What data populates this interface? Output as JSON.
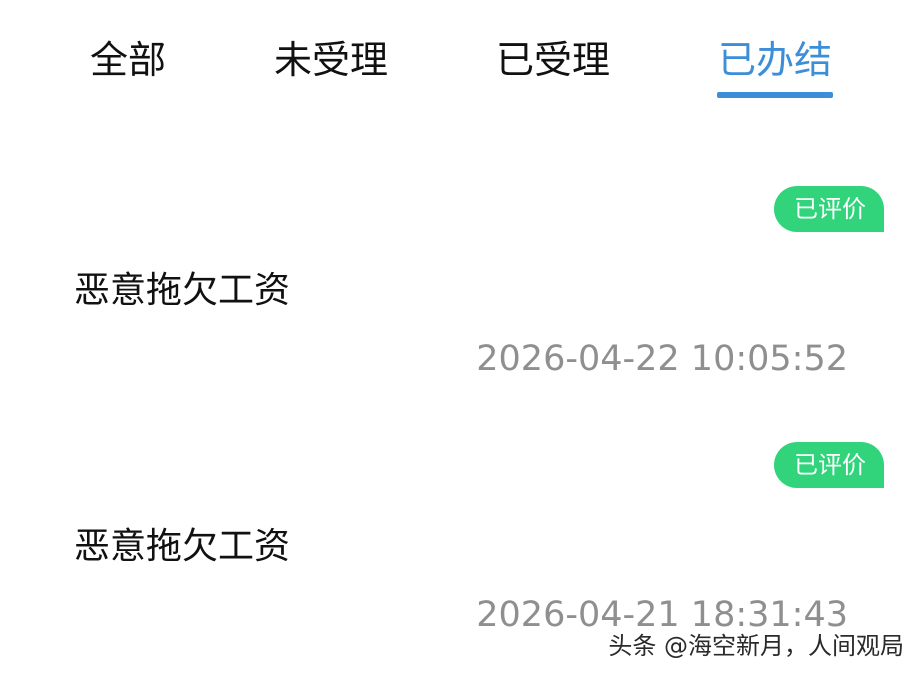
{
  "tabs": [
    {
      "label": "全部",
      "active": false
    },
    {
      "label": "未受理",
      "active": false
    },
    {
      "label": "已受理",
      "active": false
    },
    {
      "label": "已办结",
      "active": true
    }
  ],
  "colors": {
    "accent": "#3d8ed8",
    "badge": "#31d37b",
    "time_text": "#8f8f8f"
  },
  "items": [
    {
      "badge": "已评价",
      "title": "恶意拖欠工资",
      "time": "2026-04-22 10:05:52"
    },
    {
      "badge": "已评价",
      "title": "恶意拖欠工资",
      "time": "2026-04-21 18:31:43"
    }
  ],
  "watermark": "头条 @海空新月，人间观局"
}
